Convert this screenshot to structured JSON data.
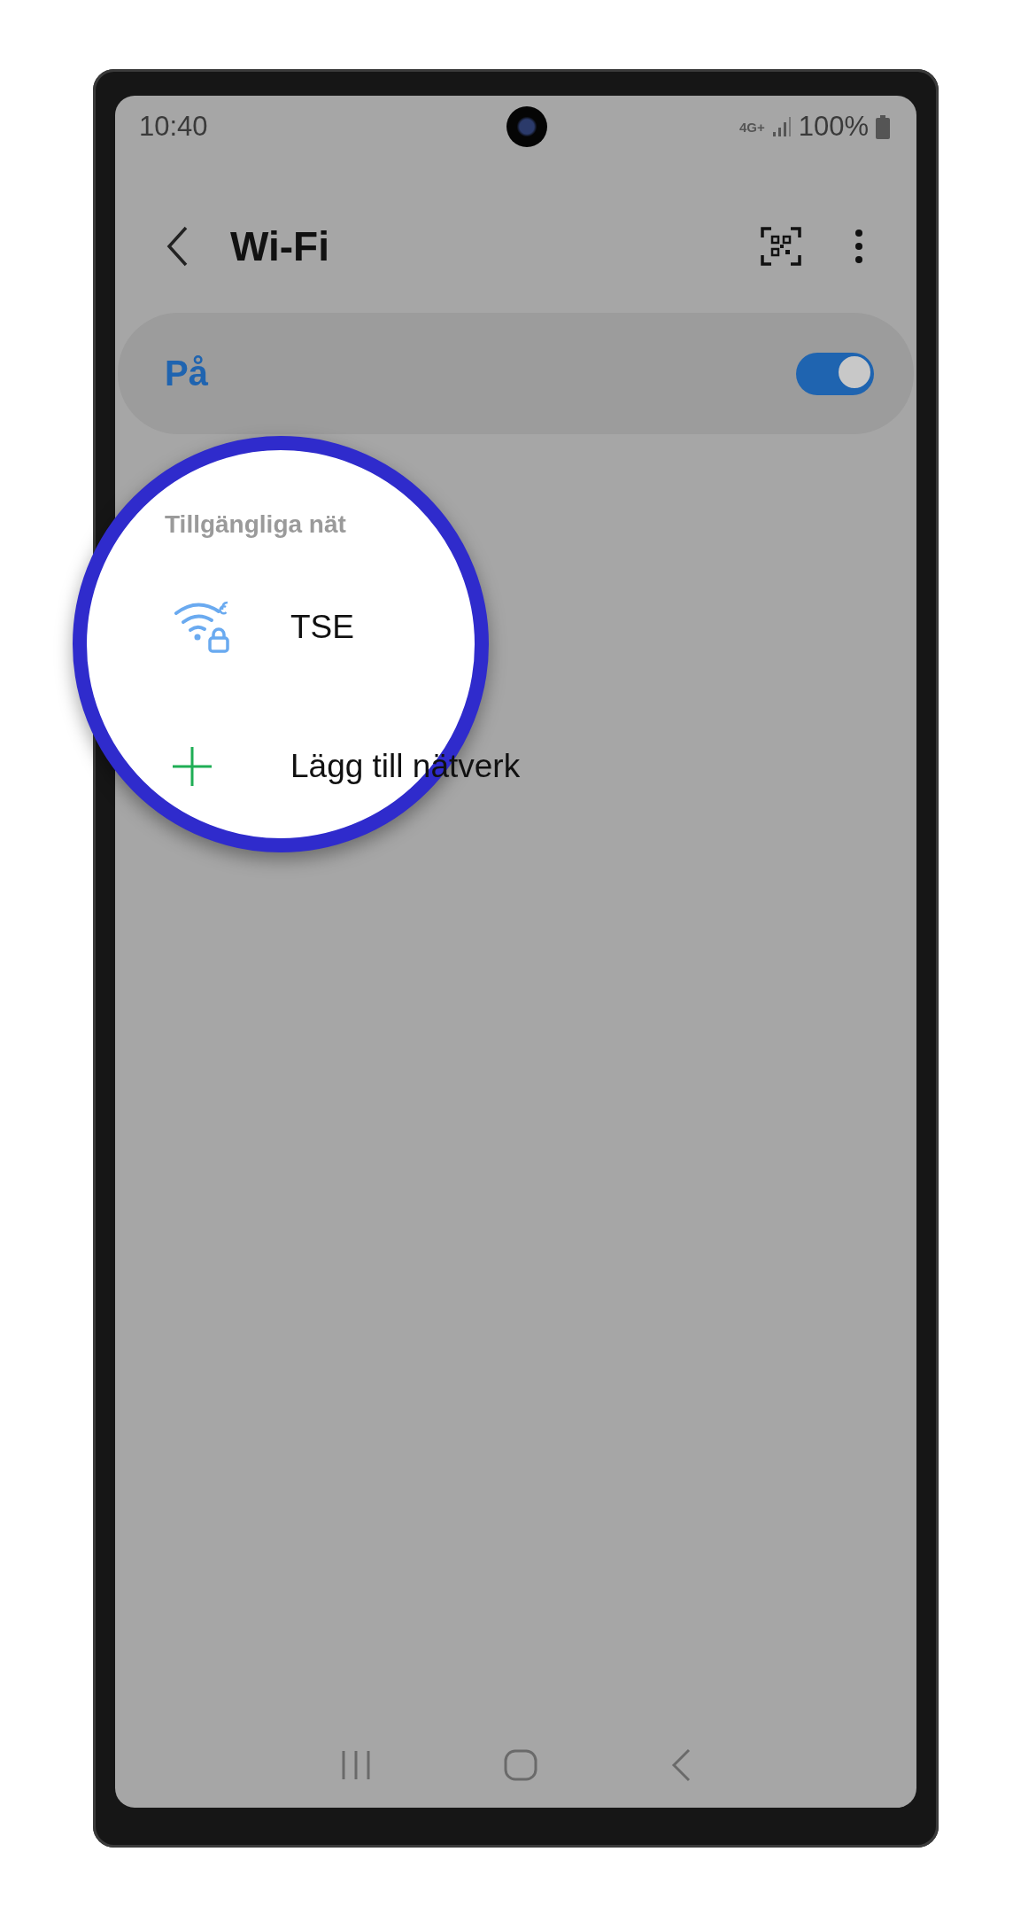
{
  "status_bar": {
    "time": "10:40",
    "network": "4G+",
    "battery": "100%"
  },
  "header": {
    "title": "Wi-Fi"
  },
  "wifi_switch": {
    "label": "På",
    "on": true
  },
  "section_title": "Tillgängliga nät",
  "networks": [
    {
      "name": "TSE",
      "kind": "network"
    },
    {
      "name": "Lägg till nätverk",
      "kind": "add"
    }
  ]
}
